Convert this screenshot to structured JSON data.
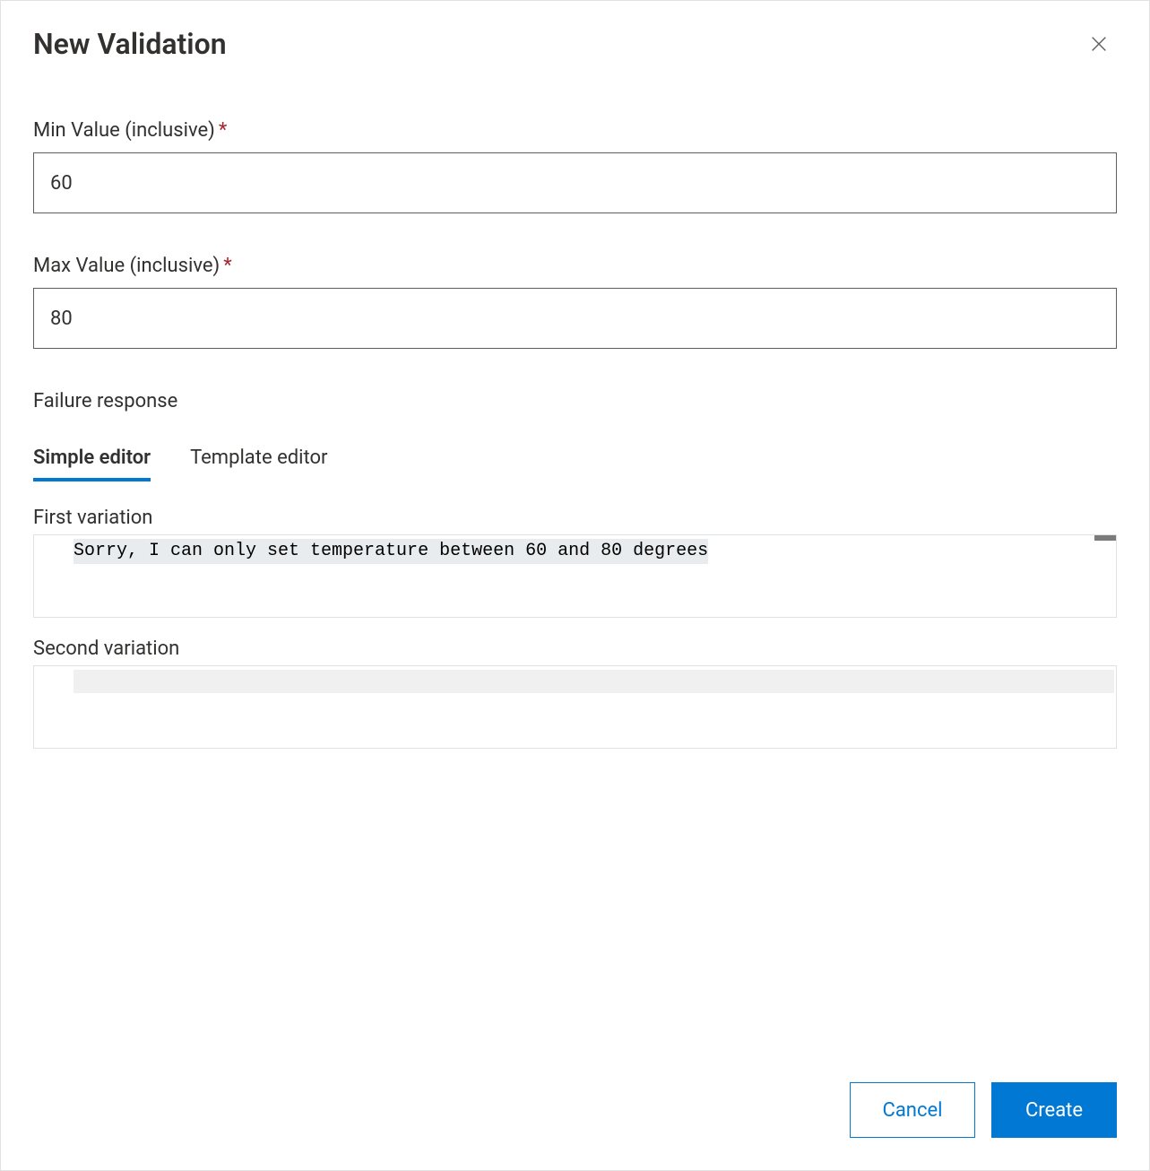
{
  "dialog": {
    "title": "New Validation",
    "fields": {
      "min": {
        "label": "Min Value (inclusive)",
        "value": "60"
      },
      "max": {
        "label": "Max Value (inclusive)",
        "value": "80"
      }
    },
    "failure_label": "Failure response",
    "tabs": {
      "simple": "Simple editor",
      "template": "Template editor"
    },
    "variations": {
      "first": {
        "label": "First variation",
        "text": "Sorry, I can only set temperature between 60 and 80 degrees"
      },
      "second": {
        "label": "Second variation",
        "text": ""
      }
    },
    "buttons": {
      "cancel": "Cancel",
      "create": "Create"
    }
  }
}
